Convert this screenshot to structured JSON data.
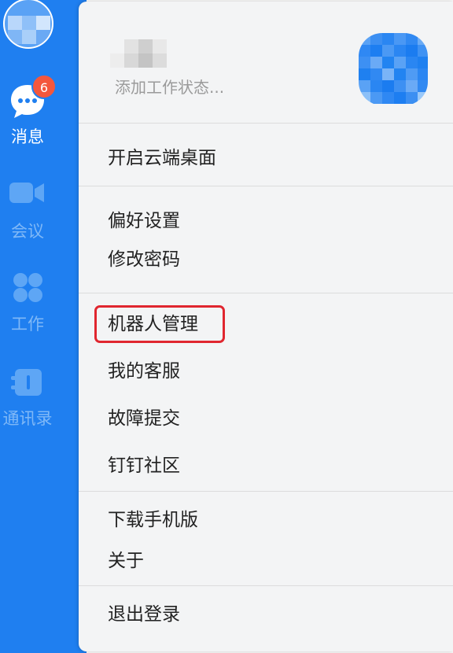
{
  "sidebar": {
    "nav": [
      {
        "id": "messages",
        "label": "消息",
        "icon": "chat-bubble-icon",
        "active": true,
        "badge": "6"
      },
      {
        "id": "meetings",
        "label": "会议",
        "icon": "video-camera-icon",
        "active": false
      },
      {
        "id": "work",
        "label": "工作",
        "icon": "apps-grid-icon",
        "active": false
      },
      {
        "id": "contacts",
        "label": "通讯录",
        "icon": "address-book-icon",
        "active": false
      }
    ]
  },
  "menu": {
    "status_placeholder": "添加工作状态...",
    "items": [
      {
        "label": "开启云端桌面"
      },
      {
        "label": "偏好设置"
      },
      {
        "label": "修改密码"
      },
      {
        "label": "机器人管理",
        "highlighted": true
      },
      {
        "label": "我的客服"
      },
      {
        "label": "故障提交"
      },
      {
        "label": "钉钉社区"
      },
      {
        "label": "下载手机版"
      },
      {
        "label": "关于"
      },
      {
        "label": "退出登录"
      }
    ]
  },
  "colors": {
    "sidebar_bg": "#1f7ff0",
    "badge": "#f4573d",
    "highlight_border": "#e0262f",
    "menu_bg": "#f3f4f5"
  }
}
